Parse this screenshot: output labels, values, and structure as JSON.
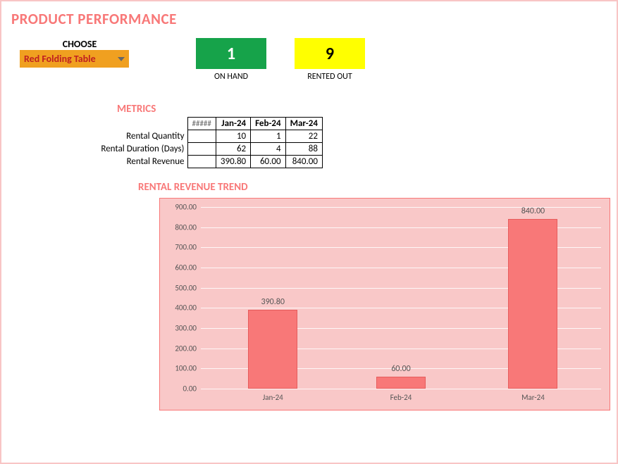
{
  "title": "PRODUCT PERFORMANCE",
  "choose": {
    "label": "CHOOSE",
    "selected": "Red Folding Table"
  },
  "stats": {
    "on_hand": {
      "value": "1",
      "label": "ON HAND"
    },
    "rented_out": {
      "value": "9",
      "label": "RENTED OUT"
    }
  },
  "metrics": {
    "title": "METRICS",
    "hash": "#####",
    "headers": [
      "Jan-24",
      "Feb-24",
      "Mar-24"
    ],
    "rows": [
      {
        "label": "Rental Quantity",
        "vals": [
          "10",
          "1",
          "22"
        ]
      },
      {
        "label": "Rental Duration (Days)",
        "vals": [
          "62",
          "4",
          "88"
        ]
      },
      {
        "label": "Rental Revenue",
        "vals": [
          "390.80",
          "60.00",
          "840.00"
        ]
      }
    ]
  },
  "chart_title": "RENTAL REVENUE TREND",
  "chart_data": {
    "type": "bar",
    "categories": [
      "Jan-24",
      "Feb-24",
      "Mar-24"
    ],
    "values": [
      390.8,
      60.0,
      840.0
    ],
    "value_labels": [
      "390.80",
      "60.00",
      "840.00"
    ],
    "ylim": [
      0,
      900
    ],
    "y_ticks": [
      "0.00",
      "100.00",
      "200.00",
      "300.00",
      "400.00",
      "500.00",
      "600.00",
      "700.00",
      "800.00",
      "900.00"
    ],
    "title": "RENTAL REVENUE TREND",
    "xlabel": "",
    "ylabel": ""
  }
}
